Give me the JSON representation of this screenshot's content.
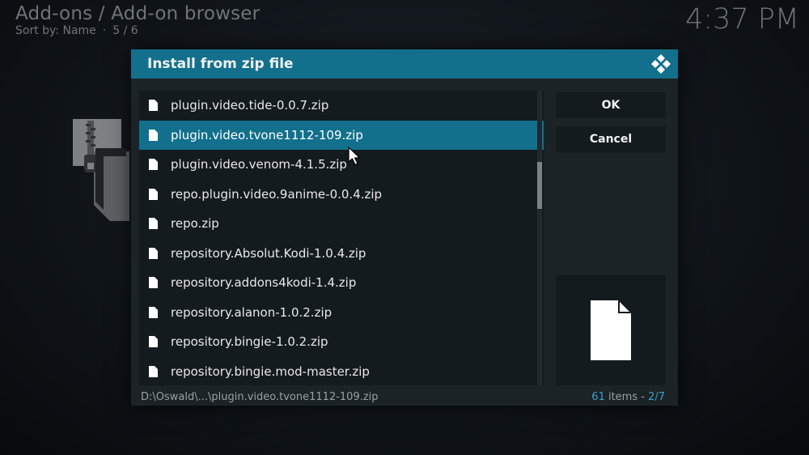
{
  "header": {
    "title": "Add-ons / Add-on browser",
    "sort_label": "Sort by: Name",
    "separator": "·",
    "position": "5 / 6",
    "clock": "4:37 PM"
  },
  "dialog": {
    "title": "Install from zip file",
    "logo_icon": "kodi-logo-icon",
    "files": [
      {
        "name": "plugin.video.tide-0.0.7.zip",
        "selected": false
      },
      {
        "name": "plugin.video.tvone1112-109.zip",
        "selected": true
      },
      {
        "name": "plugin.video.venom-4.1.5.zip",
        "selected": false
      },
      {
        "name": "repo.plugin.video.9anime-0.0.4.zip",
        "selected": false
      },
      {
        "name": "repo.zip",
        "selected": false
      },
      {
        "name": "repository.Absolut.Kodi-1.0.4.zip",
        "selected": false
      },
      {
        "name": "repository.addons4kodi-1.4.zip",
        "selected": false
      },
      {
        "name": "repository.alanon-1.0.2.zip",
        "selected": false
      },
      {
        "name": "repository.bingie-1.0.2.zip",
        "selected": false
      },
      {
        "name": "repository.bingie.mod-master.zip",
        "selected": false
      }
    ],
    "ok_label": "OK",
    "cancel_label": "Cancel",
    "preview_icon": "file-icon",
    "current_path": "D:\\Oswald\\...\\plugin.video.tvone1112-109.zip",
    "item_count": "61",
    "items_label": " items - ",
    "page": "2/7"
  },
  "colors": {
    "accent": "#12708c",
    "count_accent": "#3aa0c8",
    "dialog_bg": "#1b2327",
    "panel_bg": "#141b1f"
  }
}
